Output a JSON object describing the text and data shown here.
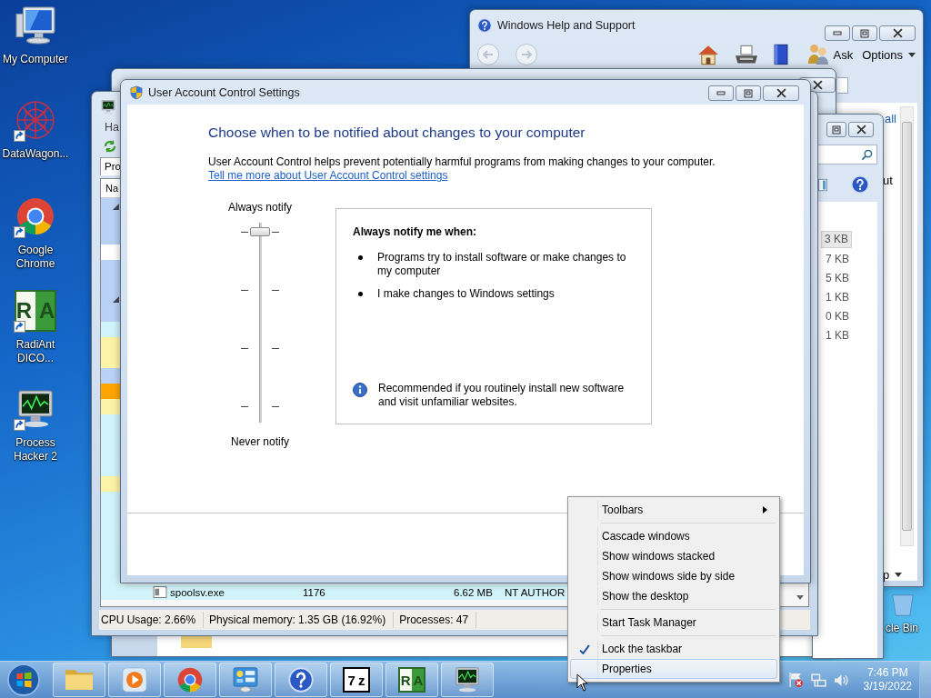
{
  "desktop_icons": [
    {
      "kind": "computer",
      "label": "My Computer",
      "shortcut": false
    },
    {
      "kind": "mesh",
      "label": "DataWagon...",
      "shortcut": true
    },
    {
      "kind": "browser",
      "label": "Google Chrome",
      "shortcut": true
    },
    {
      "kind": "logo_split",
      "logo_text": "RA",
      "label": "RadiAnt DICO...",
      "shortcut": true
    },
    {
      "kind": "monitor_graph",
      "label": "Process Hacker 2",
      "shortcut": true
    }
  ],
  "recycle_bin": {
    "label": "cle Bin"
  },
  "help_window": {
    "title": "Windows Help and Support",
    "ask": "Ask",
    "options": "Options",
    "content": [
      "all",
      "ut"
    ],
    "footer": "p"
  },
  "explorer_window": {
    "sizes": [
      {
        "text": "3 KB",
        "selected": true
      },
      {
        "text": "7 KB",
        "selected": false
      },
      {
        "text": "5 KB",
        "selected": false
      },
      {
        "text": "1 KB",
        "selected": false
      },
      {
        "text": "0 KB",
        "selected": false
      },
      {
        "text": "1 KB",
        "selected": false
      }
    ]
  },
  "process_hacker": {
    "menu": "Ha",
    "tab": "Pro",
    "column": "Na",
    "rows": [
      {
        "color": "#b9d1f5",
        "expanded": true
      },
      {
        "color": "#b9d1f5",
        "expanded": false
      },
      {
        "color": "#b9d1f5",
        "expanded": false
      },
      {
        "color": "#ffffff",
        "expanded": false
      },
      {
        "color": "#b9d1f5",
        "expanded": false
      },
      {
        "color": "#b9d1f5",
        "expanded": false
      },
      {
        "color": "#b9d1f5",
        "expanded": true
      },
      {
        "color": "#b9d1f5",
        "expanded": false
      },
      {
        "color": "#d0f4fa",
        "expanded": false
      },
      {
        "color": "#fff3a8",
        "expanded": false
      },
      {
        "color": "#fff3a8",
        "expanded": false
      },
      {
        "color": "#b9d1f5",
        "expanded": false
      },
      {
        "color": "#ffa500",
        "expanded": false
      },
      {
        "color": "#fff3a8",
        "expanded": false
      },
      {
        "color": "#d0f4fa",
        "expanded": false
      },
      {
        "color": "#d0f4fa",
        "expanded": false
      },
      {
        "color": "#d0f4fa",
        "expanded": false
      },
      {
        "color": "#d0f4fa",
        "expanded": false
      },
      {
        "color": "#fff3a8",
        "expanded": false
      },
      {
        "color": "#d0f4fa",
        "expanded": false
      },
      {
        "color": "#d0f4fa",
        "expanded": false
      },
      {
        "color": "#d0f4fa",
        "expanded": false
      },
      {
        "color": "#d0f4fa",
        "expanded": false
      },
      {
        "color": "#d0f4fa",
        "expanded": false
      },
      {
        "color": "#d0f4fa",
        "expanded": false
      },
      {
        "color": "#d0f4fa",
        "expanded": false,
        "name": "spoolsv.exe",
        "pid": "1176",
        "memory": "6.62 MB",
        "user": "NT AUTHOR"
      }
    ],
    "status": [
      "CPU Usage: 2.66%",
      "Physical memory: 1.35 GB (16.92%)",
      "Processes: 47"
    ]
  },
  "uac": {
    "title": "User Account Control Settings",
    "heading": "Choose when to be notified about changes to your computer",
    "description": "User Account Control helps prevent potentially harmful programs from making changes to your computer.",
    "link": "Tell me more about User Account Control settings",
    "slider": {
      "top_label": "Always notify",
      "bottom_label": "Never notify",
      "level": 1
    },
    "info": {
      "title": "Always notify me when:",
      "bullets": [
        "Programs try to install software or make changes to my computer",
        "I make changes to Windows settings"
      ],
      "note": "Recommended if you routinely install new software and visit unfamiliar websites."
    }
  },
  "context_menu": {
    "groups": [
      [
        {
          "label": "Toolbars",
          "kind": "submenu",
          "checked": false,
          "selected": false
        }
      ],
      [
        {
          "label": "Cascade windows",
          "kind": "command",
          "checked": false,
          "selected": false
        },
        {
          "label": "Show windows stacked",
          "kind": "command",
          "checked": false,
          "selected": false
        },
        {
          "label": "Show windows side by side",
          "kind": "command",
          "checked": false,
          "selected": false
        },
        {
          "label": "Show the desktop",
          "kind": "command",
          "checked": false,
          "selected": false
        }
      ],
      [
        {
          "label": "Start Task Manager",
          "kind": "command",
          "checked": false,
          "selected": false
        }
      ],
      [
        {
          "label": "Lock the taskbar",
          "kind": "command",
          "checked": true,
          "selected": false
        },
        {
          "label": "Properties",
          "kind": "command",
          "checked": false,
          "selected": true
        }
      ]
    ]
  },
  "taskbar": {
    "buttons": [
      {
        "kind": "folder"
      },
      {
        "kind": "media"
      },
      {
        "kind": "browser"
      },
      {
        "kind": "control_panel"
      },
      {
        "kind": "help"
      },
      {
        "kind": "logo_boxed",
        "logo_text": "7z"
      },
      {
        "kind": "logo_split",
        "logo_text": "RA"
      },
      {
        "kind": "monitor_graph"
      }
    ],
    "clock": {
      "time": "7:46 PM",
      "date": "3/19/2022"
    }
  }
}
